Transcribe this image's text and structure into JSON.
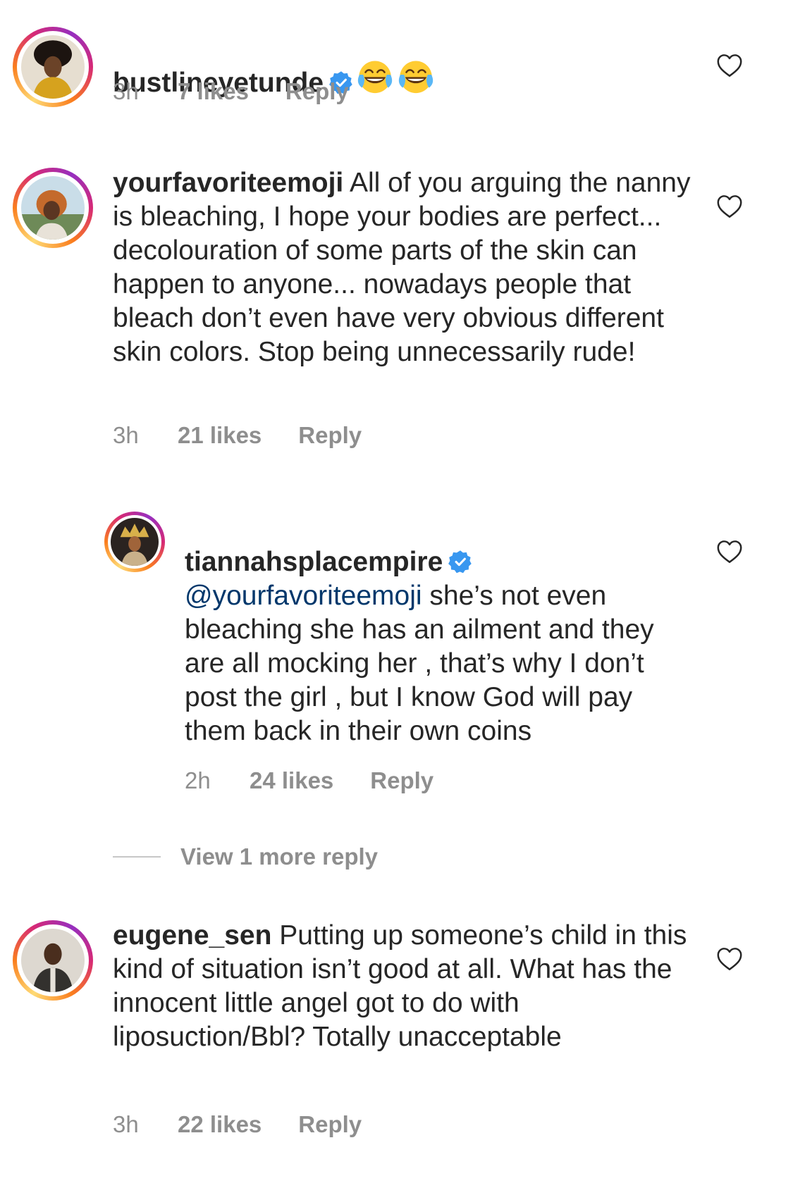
{
  "comments": [
    {
      "username": "bustlineyetunde",
      "verified": true,
      "text": "",
      "emojis": [
        "face-with-tears-of-joy",
        "face-with-tears-of-joy"
      ],
      "time": "3h",
      "likes": "7 likes",
      "reply": "Reply"
    },
    {
      "username": "yourfavoriteemoji",
      "verified": false,
      "text": "All of you arguing the nanny is bleaching, I hope your bodies are perfect... decolouration of some parts of the skin can happen to anyone... nowadays people that bleach don’t even have very obvious different skin colors. Stop being unnecessarily rude!",
      "time": "3h",
      "likes": "21 likes",
      "reply": "Reply"
    },
    {
      "username": "tiannahsplacempire",
      "verified": true,
      "mention": "@yourfavoriteemoji",
      "text": "she’s not even bleaching she has an ailment and they are all mocking her , that’s why I don’t post the girl , but I know God will pay them back in their own coins",
      "time": "2h",
      "likes": "24 likes",
      "reply": "Reply"
    },
    {
      "username": "eugene_sen",
      "verified": false,
      "text": "Putting up someone’s child in this kind of situation isn’t good at all. What has the innocent little angel got to do with liposuction/Bbl? Totally unacceptable",
      "time": "3h",
      "likes": "22 likes",
      "reply": "Reply"
    }
  ],
  "view_more_replies": "View 1 more reply",
  "icons": {
    "verified": "verified-badge-icon",
    "like": "heart-outline-icon",
    "emoji": "face-with-tears-of-joy-emoji"
  },
  "colors": {
    "text": "#262626",
    "meta": "#8e8e8e",
    "mention": "#00376b",
    "verified": "#3897f0",
    "divider": "#c7c7c7"
  }
}
